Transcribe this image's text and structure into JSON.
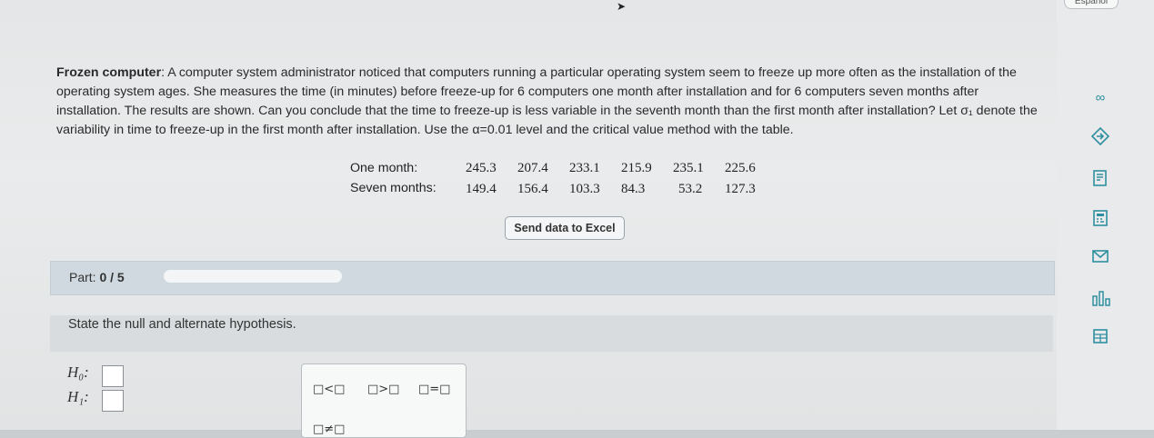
{
  "problem": {
    "title": "Frozen computer",
    "text": ": A computer system administrator noticed that computers running a particular operating system seem to freeze up more often as the installation of the operating system ages. She measures the time (in minutes) before freeze-up for 6 computers one month after installation and for 6 computers seven months after installation. The results are shown. Can you conclude that the time to freeze-up is less variable in the seventh month than the first month after installation? Let σ₁ denote the variability in time to freeze-up in the first month after installation. Use the α=0.01 level and the critical value method with the table."
  },
  "table": {
    "row1_label": "One month:",
    "row2_label": "Seven months:",
    "one_month": [
      "245.3",
      "207.4",
      "233.1",
      "215.9",
      "235.1",
      "225.6"
    ],
    "seven_months": [
      "149.4",
      "156.4",
      "103.3",
      "84.3",
      "53.2",
      "127.3"
    ]
  },
  "excel_button": "Send data to Excel",
  "part": {
    "label": "Part:",
    "value": "0 / 5",
    "progress": 0
  },
  "question": "State the null and alternate hypothesis.",
  "hypotheses": {
    "h0": "H₀:",
    "h1": "H₁:"
  },
  "symbols": [
    "□<□",
    "□>□",
    "□=□",
    "□≠□"
  ],
  "sidebar": {
    "espanol": "Español",
    "icons": [
      "infinity-icon",
      "forward-icon",
      "textbook-icon",
      "calculator-icon",
      "mail-icon",
      "bar-chart-icon",
      "data-table-icon"
    ]
  },
  "colors": {
    "accent": "#2f8fa0",
    "progress": "#2e7fbf"
  }
}
